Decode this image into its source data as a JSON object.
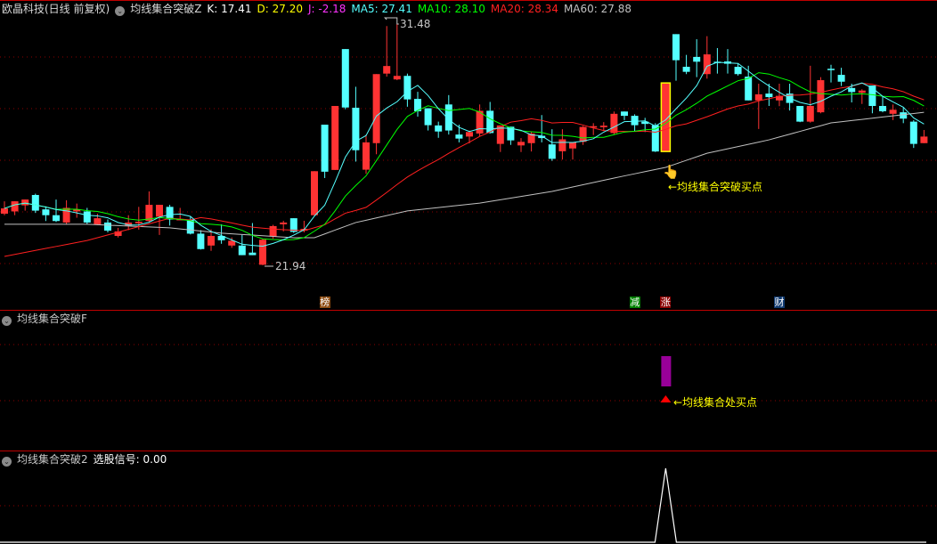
{
  "header": {
    "stock": "欧晶科技(日线 前复权)",
    "indicator": "均线集合突破Z",
    "k": "K: 17.41",
    "d": "D: 27.20",
    "j": "J: -2.18",
    "ma5": "MA5: 27.41",
    "ma10": "MA10: 28.10",
    "ma20": "MA20: 28.34",
    "ma60": "MA60: 27.88"
  },
  "colors": {
    "up": "#ff3333",
    "down": "#54ffff",
    "ma5": "#54ffff",
    "ma10": "#00ff00",
    "ma20": "#ff2020",
    "ma60": "#c0c0c0",
    "grid": "#8b0000",
    "signal": "#ffff00"
  },
  "annotations": {
    "high_label": "31.48",
    "low_label": "21.94",
    "buy_main": "←均线集合突破买点",
    "buy_sub": "←均线集合处买点"
  },
  "markers": [
    {
      "text": "榜",
      "index": 31,
      "color": "#8b4a10"
    },
    {
      "text": "减",
      "index": 61,
      "color": "#008000"
    },
    {
      "text": "涨",
      "index": 64,
      "color": "#8b0000"
    },
    {
      "text": "财",
      "index": 75,
      "color": "#103a70"
    }
  ],
  "panel2": {
    "title": "均线集合突破F"
  },
  "panel3": {
    "title": "均线集合突破2",
    "value_label": "选股信号: 0.00"
  },
  "chart_data": {
    "type": "candlestick",
    "ylim": [
      21.0,
      32.4
    ],
    "signal_index": 64,
    "ohlc": [
      [
        23.98,
        24.19,
        24.47,
        23.92
      ],
      [
        24.07,
        24.47,
        24.47,
        23.92
      ],
      [
        24.31,
        24.54,
        24.54,
        24.1
      ],
      [
        24.72,
        24.1,
        24.77,
        24.01
      ],
      [
        24.15,
        23.92,
        24.27,
        23.69
      ],
      [
        23.92,
        23.69,
        24.54,
        23.65
      ],
      [
        23.63,
        24.21,
        24.51,
        23.55
      ],
      [
        24.07,
        24.14,
        24.38,
        23.82
      ],
      [
        24.07,
        23.63,
        24.21,
        23.57
      ],
      [
        23.56,
        23.8,
        23.98,
        23.53
      ],
      [
        23.63,
        23.31,
        23.75,
        23.24
      ],
      [
        23.1,
        23.28,
        23.42,
        23.04
      ],
      [
        23.51,
        23.63,
        23.92,
        23.33
      ],
      [
        23.6,
        23.66,
        24.25,
        23.35
      ],
      [
        23.69,
        24.33,
        24.86,
        23.65
      ],
      [
        23.86,
        24.33,
        24.33,
        23.14
      ],
      [
        24.25,
        23.75,
        24.33,
        23.51
      ],
      [
        23.72,
        23.77,
        24.21,
        23.72
      ],
      [
        23.75,
        23.19,
        23.86,
        23.16
      ],
      [
        23.19,
        22.58,
        23.33,
        22.56
      ],
      [
        22.72,
        23.1,
        23.36,
        22.51
      ],
      [
        23.1,
        22.93,
        23.56,
        22.79
      ],
      [
        22.72,
        22.91,
        23.04,
        22.63
      ],
      [
        22.72,
        22.34,
        23.14,
        22.34
      ],
      [
        22.44,
        22.34,
        23.61,
        22.34
      ],
      [
        21.96,
        22.95,
        22.99,
        21.94
      ],
      [
        23.08,
        23.49,
        23.54,
        22.99
      ],
      [
        23.56,
        23.63,
        23.7,
        23.28
      ],
      [
        23.8,
        23.26,
        23.8,
        23.22
      ],
      [
        23.31,
        23.38,
        23.7,
        23.24
      ],
      [
        23.92,
        25.66,
        25.66,
        23.92
      ],
      [
        27.5,
        25.64,
        27.5,
        25.39
      ],
      [
        25.71,
        28.24,
        28.24,
        25.71
      ],
      [
        30.49,
        28.18,
        30.49,
        28.11
      ],
      [
        28.17,
        26.49,
        29.0,
        26.04
      ],
      [
        25.72,
        26.8,
        27.11,
        25.56
      ],
      [
        26.77,
        29.5,
        29.5,
        26.33
      ],
      [
        29.52,
        29.82,
        31.4,
        29.4
      ],
      [
        29.29,
        29.43,
        31.48,
        29.26
      ],
      [
        29.43,
        28.5,
        29.52,
        28.21
      ],
      [
        28.52,
        28.03,
        28.8,
        27.82
      ],
      [
        28.15,
        27.48,
        28.15,
        27.27
      ],
      [
        27.47,
        27.23,
        27.62,
        26.98
      ],
      [
        28.3,
        27.27,
        28.67,
        27.11
      ],
      [
        27.11,
        26.95,
        27.5,
        26.8
      ],
      [
        27.03,
        27.21,
        27.27,
        26.76
      ],
      [
        27.15,
        28.05,
        28.3,
        27.03
      ],
      [
        28.05,
        27.17,
        28.4,
        27.15
      ],
      [
        26.74,
        27.47,
        27.47,
        26.42
      ],
      [
        27.42,
        26.88,
        27.42,
        26.7
      ],
      [
        26.68,
        26.82,
        26.97,
        26.42
      ],
      [
        26.77,
        27.15,
        27.21,
        26.44
      ],
      [
        27.06,
        26.97,
        27.88,
        26.8
      ],
      [
        26.72,
        26.15,
        27.32,
        26.07
      ],
      [
        26.45,
        26.92,
        27.32,
        26.12
      ],
      [
        26.56,
        26.8,
        26.8,
        26.12
      ],
      [
        26.82,
        27.41,
        27.45,
        26.7
      ],
      [
        27.38,
        27.44,
        27.56,
        27.09
      ],
      [
        27.4,
        27.46,
        27.6,
        27.25
      ],
      [
        27.17,
        27.93,
        28.02,
        27.1
      ],
      [
        28.02,
        27.85,
        28.02,
        27.68
      ],
      [
        27.85,
        27.48,
        27.91,
        27.23
      ],
      [
        27.62,
        27.53,
        27.77,
        27.21
      ],
      [
        27.48,
        26.44,
        27.56,
        26.42
      ],
      [
        26.44,
        29.15,
        29.15,
        26.44
      ],
      [
        31.08,
        30.05,
        31.08,
        29.24
      ],
      [
        29.79,
        29.59,
        30.26,
        29.5
      ],
      [
        30.18,
        29.99,
        30.88,
        29.38
      ],
      [
        29.5,
        30.28,
        31.0,
        29.32
      ],
      [
        29.99,
        29.94,
        30.53,
        29.52
      ],
      [
        30.0,
        29.91,
        30.49,
        29.52
      ],
      [
        29.79,
        29.5,
        29.93,
        29.44
      ],
      [
        29.4,
        28.46,
        29.83,
        28.46
      ],
      [
        28.46,
        28.7,
        29.12,
        27.33
      ],
      [
        28.73,
        28.59,
        29.12,
        28.24
      ],
      [
        28.46,
        28.64,
        29.12,
        28.23
      ],
      [
        28.73,
        28.36,
        29.12,
        28.06
      ],
      [
        28.24,
        27.62,
        28.24,
        27.6
      ],
      [
        27.62,
        28.24,
        29.83,
        27.58
      ],
      [
        27.99,
        29.26,
        29.38,
        27.95
      ],
      [
        29.71,
        29.66,
        29.87,
        29.17
      ],
      [
        29.47,
        29.2,
        29.75,
        29.03
      ],
      [
        28.95,
        28.79,
        29.12,
        28.38
      ],
      [
        28.76,
        28.85,
        28.9,
        28.32
      ],
      [
        29.05,
        28.24,
        29.05,
        27.95
      ],
      [
        28.24,
        28.03,
        28.62,
        27.99
      ],
      [
        27.93,
        28.09,
        28.3,
        27.68
      ],
      [
        27.99,
        27.74,
        28.17,
        27.56
      ],
      [
        27.62,
        26.74,
        27.68,
        26.58
      ],
      [
        26.77,
        27.03,
        27.29,
        26.77
      ]
    ],
    "ma20_head": [
      [
        0,
        22.29
      ],
      [
        8,
        22.92
      ],
      [
        16,
        23.8
      ],
      [
        19,
        23.7
      ]
    ],
    "ma60_points": [
      [
        0,
        23.56
      ],
      [
        8,
        23.56
      ],
      [
        16,
        23.42
      ],
      [
        21,
        23.21
      ],
      [
        28,
        23.03
      ],
      [
        30,
        23.03
      ],
      [
        34,
        23.63
      ],
      [
        39,
        24.09
      ],
      [
        46,
        24.4
      ],
      [
        53,
        24.86
      ],
      [
        59,
        25.39
      ],
      [
        64,
        25.81
      ],
      [
        68,
        26.37
      ],
      [
        74,
        26.9
      ],
      [
        80,
        27.57
      ],
      [
        89,
        27.99
      ]
    ],
    "signal_panel": {
      "index": 64,
      "peak": 1,
      "base": 0
    }
  }
}
